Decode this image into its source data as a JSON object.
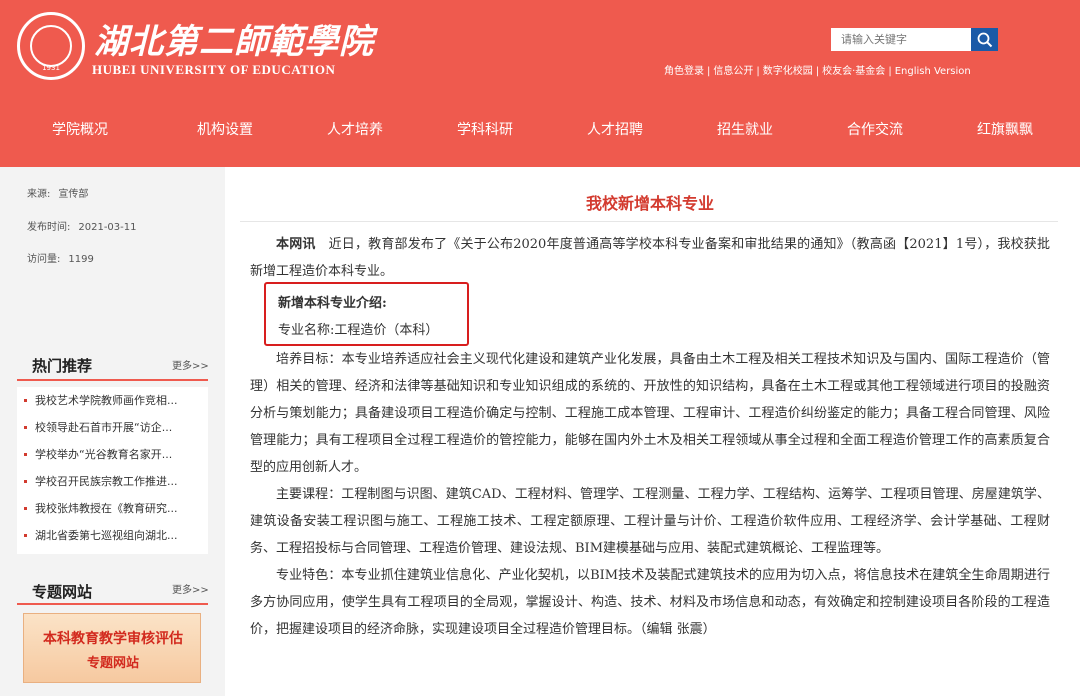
{
  "header": {
    "logo_cn": "湖北第二師範學院",
    "logo_en": "HUBEI UNIVERSITY OF EDUCATION",
    "logo_year": "1931",
    "search_placeholder": "请输入关键字",
    "top_links": [
      "角色登录",
      "信息公开",
      "数字化校园",
      "校友会·基金会",
      "English Version"
    ],
    "top_link_sep": "|"
  },
  "nav": [
    "学院概况",
    "机构设置",
    "人才培养",
    "学科科研",
    "人才招聘",
    "招生就业",
    "合作交流",
    "红旗飘飘"
  ],
  "meta": {
    "source_label": "来源:",
    "source_value": "宣传部",
    "date_label": "发布时间:",
    "date_value": "2021-03-11",
    "views_label": "访问量:",
    "views_value": "1199"
  },
  "hot": {
    "title": "热门推荐",
    "more": "更多>>",
    "items": [
      "我校艺术学院教师画作竞相...",
      "校领导赴石首市开展“访企...",
      "学校举办“光谷教育名家开...",
      "学校召开民族宗教工作推进...",
      "我校张炜教授在《教育研究...",
      "湖北省委第七巡视组向湖北..."
    ]
  },
  "topics": {
    "title": "专题网站",
    "more": "更多>>",
    "banner_line1": "本科教育教学审核评估",
    "banner_line2": "专题网站"
  },
  "article": {
    "title": "我校新增本科专业",
    "intro_lead": "本网讯",
    "intro_text": "近日，教育部发布了《关于公布2020年度普通高等学校本科专业备案和审批结果的通知》（教高函【2021】1号），我校获批新增工程造价本科专业。",
    "new_major_heading": "新增本科专业介绍:",
    "major_name": "专业名称:工程造价（本科）",
    "goals": "培养目标：本专业培养适应社会主义现代化建设和建筑产业化发展，具备由土木工程及相关工程技术知识及与国内、国际工程造价（管理）相关的管理、经济和法律等基础知识和专业知识组成的系统的、开放性的知识结构，具备在土木工程或其他工程领域进行项目的投融资分析与策划能力；具备建设项目工程造价确定与控制、工程施工成本管理、工程审计、工程造价纠纷鉴定的能力；具备工程合同管理、风险管理能力；具有工程项目全过程工程造价的管控能力，能够在国内外土木及相关工程领域从事全过程和全面工程造价管理工作的高素质复合型的应用创新人才。",
    "courses": "主要课程：工程制图与识图、建筑CAD、工程材料、管理学、工程测量、工程力学、工程结构、运筹学、工程项目管理、房屋建筑学、建筑设备安装工程识图与施工、工程施工技术、工程定额原理、工程计量与计价、工程造价软件应用、工程经济学、会计学基础、工程财务、工程招投标与合同管理、工程造价管理、建设法规、BIM建模基础与应用、装配式建筑概论、工程监理等。",
    "features": "专业特色：本专业抓住建筑业信息化、产业化契机，以BIM技术及装配式建筑技术的应用为切入点，将信息技术在建筑全生命周期进行多方协同应用，使学生具有工程项目的全局观，掌握设计、构造、技术、材料及市场信息和动态，有效确定和控制建设项目各阶段的工程造价，把握建设项目的经济命脉，实现建设项目全过程造价管理目标。（编辑 张震）"
  }
}
